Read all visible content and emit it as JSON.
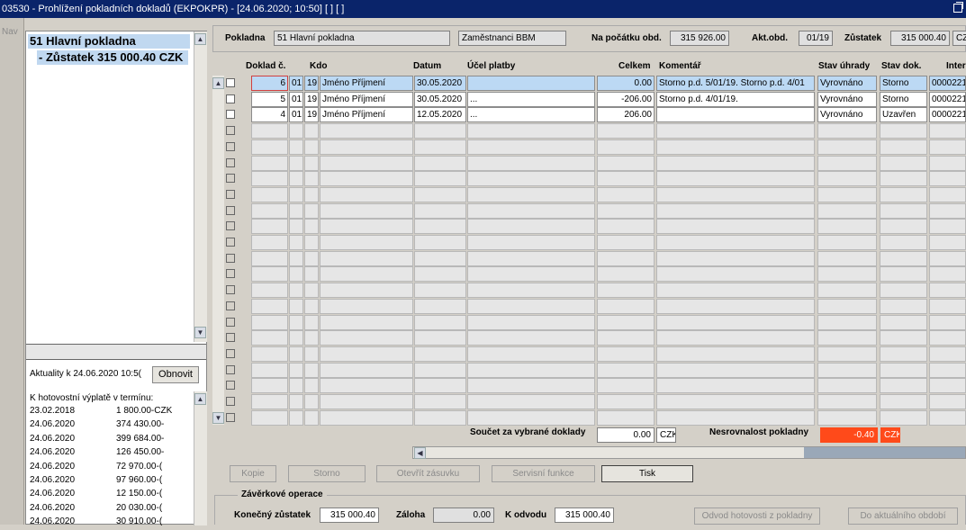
{
  "window": {
    "title": "03530 - Prohlížení pokladních dokladů (EKPOKPR) - [24.06.2020; 10:50]  [ ]  [ ]"
  },
  "nav": {
    "label": "Nav"
  },
  "tree": {
    "items": [
      "51 Hlavní pokladna",
      "- Zůstatek 315 000.40 CZK"
    ]
  },
  "actuality": {
    "label": "Aktuality k 24.06.2020 10:5(",
    "refresh_button": "Obnovit",
    "payouts_title": "K hotovostní výplatě v termínu:",
    "payouts": [
      {
        "date": "23.02.2018",
        "amount": "1 800.00-CZK"
      },
      {
        "date": "24.06.2020",
        "amount": "374 430.00-"
      },
      {
        "date": "24.06.2020",
        "amount": "399 684.00-"
      },
      {
        "date": "24.06.2020",
        "amount": "126 450.00-"
      },
      {
        "date": "24.06.2020",
        "amount": "72 970.00-("
      },
      {
        "date": "24.06.2020",
        "amount": "97 960.00-("
      },
      {
        "date": "24.06.2020",
        "amount": "12 150.00-("
      },
      {
        "date": "24.06.2020",
        "amount": "20 030.00-("
      },
      {
        "date": "24.06.2020",
        "amount": "30 910.00-("
      }
    ]
  },
  "header": {
    "pokladna_label": "Pokladna",
    "pokladna_value": "51 Hlavní pokladna",
    "group_value": "Zaměstnanci BBM",
    "start_label": "Na počátku obd.",
    "start_value": "315 926.00",
    "period_label": "Akt.obd.",
    "period_value": "01/19",
    "balance_label": "Zůstatek",
    "balance_value": "315 000.40",
    "currency_value": "CZK"
  },
  "table": {
    "columns": {
      "doklad": "Doklad č.",
      "kdo": "Kdo",
      "datum": "Datum",
      "ucel": "Účel platby",
      "celkem": "Celkem",
      "komentar": "Komentář",
      "stav_uhrady": "Stav úhrady",
      "stav_dok": "Stav dok.",
      "inter": "Inter"
    },
    "rows": [
      {
        "num": "6",
        "p": "01",
        "y": "19",
        "kdo": "Jméno Příjmení",
        "datum": "30.05.2020",
        "ucel": "",
        "celkem": "0.00",
        "komentar": "Storno p.d. 5/01/19. Storno p.d. 4/01",
        "stav_uhrady": "Vyrovnáno",
        "stav_dok": "Storno",
        "inter": "0000221"
      },
      {
        "num": "5",
        "p": "01",
        "y": "19",
        "kdo": "Jméno Příjmení",
        "datum": "30.05.2020",
        "ucel": "...",
        "celkem": "-206.00",
        "komentar": "Storno p.d. 4/01/19.",
        "stav_uhrady": "Vyrovnáno",
        "stav_dok": "Storno",
        "inter": "0000221"
      },
      {
        "num": "4",
        "p": "01",
        "y": "19",
        "kdo": "Jméno Příjmení",
        "datum": "12.05.2020",
        "ucel": "...",
        "celkem": "206.00",
        "komentar": "",
        "stav_uhrady": "Vyrovnáno",
        "stav_dok": "Uzavřen",
        "inter": "0000221"
      }
    ]
  },
  "summary": {
    "selected_label": "Součet za vybrané doklady",
    "selected_value": "0.00",
    "selected_currency": "CZK",
    "discrepancy_label": "Nesrovnalost pokladny",
    "discrepancy_value": "-0.40",
    "discrepancy_currency": "CZK",
    "discrepancy_color": "#ff4a1a"
  },
  "buttons": {
    "kopie": "Kopie",
    "storno": "Storno",
    "zasuvka": "Otevřít zásuvku",
    "servis": "Servisní funkce",
    "tisk": "Tisk"
  },
  "closing": {
    "title": "Závěrkové operace",
    "final_label": "Konečný zůstatek",
    "final_value": "315 000.40",
    "deposit_label": "Záloha",
    "deposit_value": "0.00",
    "transfer_label": "K odvodu",
    "transfer_value": "315 000.40",
    "btn_odvod": "Odvod hotovosti z pokladny",
    "btn_obdobi": "Do aktuálního období"
  }
}
